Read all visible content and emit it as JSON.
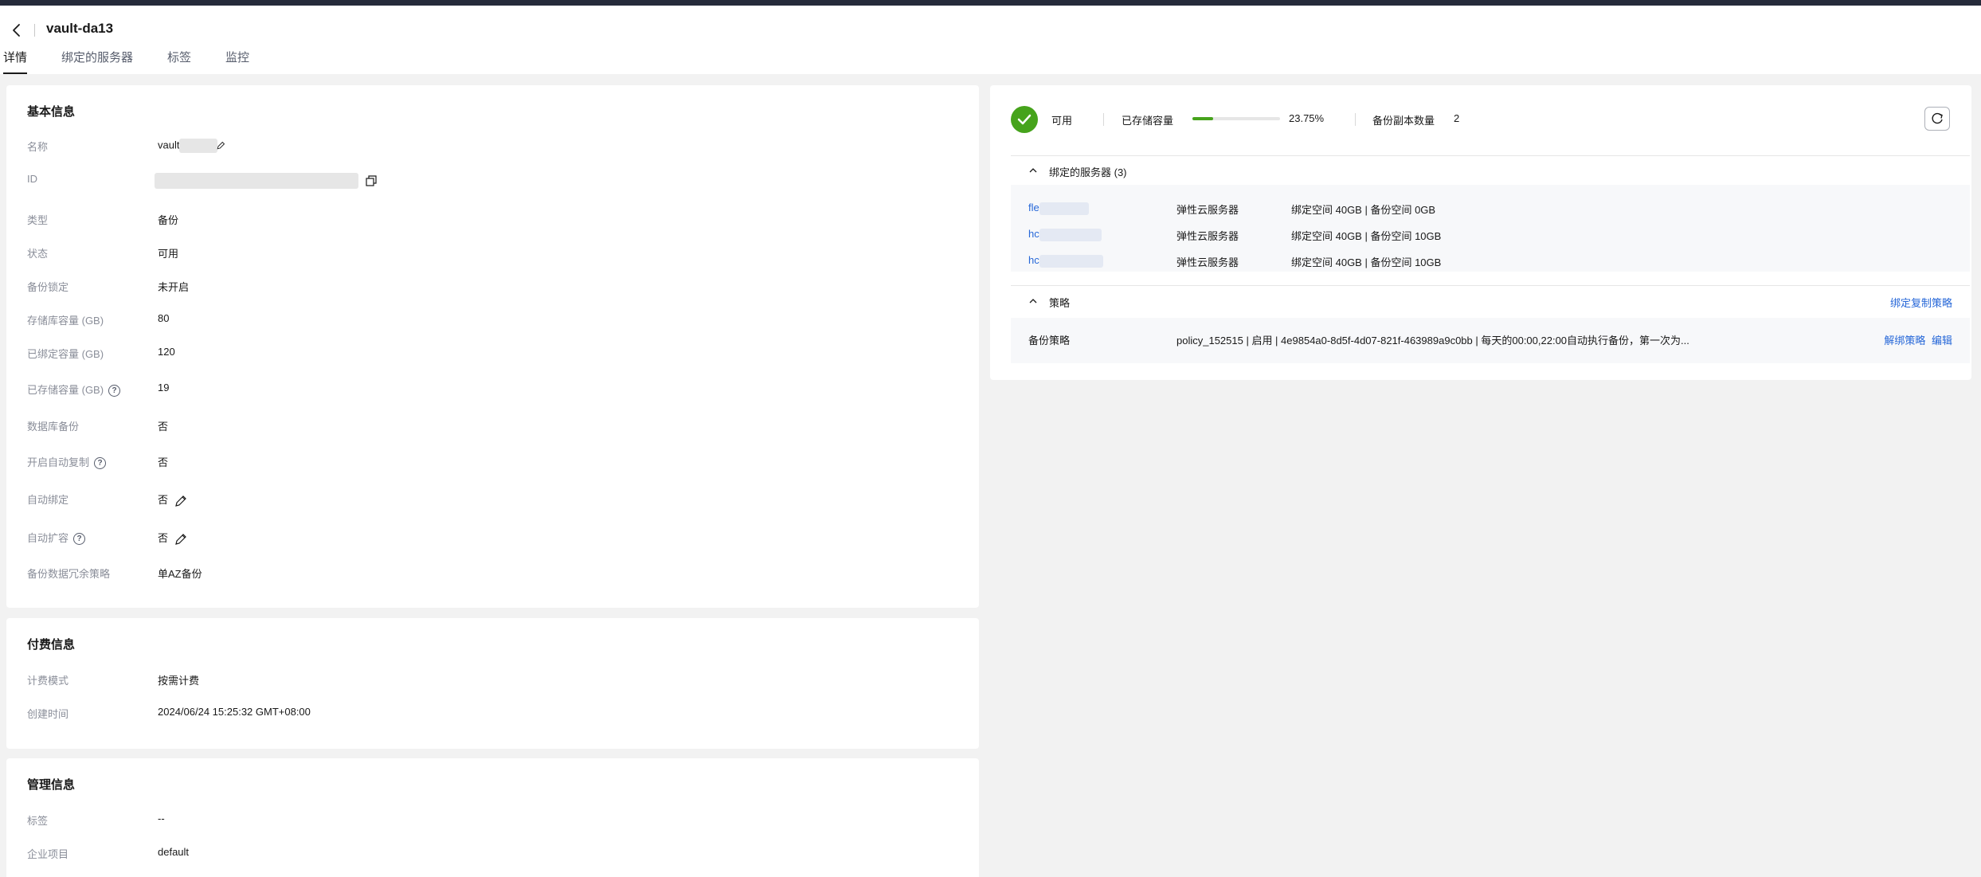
{
  "header": {
    "title": "vault-da13",
    "tabs": [
      {
        "label": "详情"
      },
      {
        "label": "绑定的服务器"
      },
      {
        "label": "标签"
      },
      {
        "label": "监控"
      }
    ]
  },
  "basic": {
    "title": "基本信息",
    "rows": [
      {
        "label": "名称",
        "value": "vault"
      },
      {
        "label": "ID",
        "value": ""
      },
      {
        "label": "类型",
        "value": "备份"
      },
      {
        "label": "状态",
        "value": "可用"
      },
      {
        "label": "备份锁定",
        "value": "未开启"
      },
      {
        "label": "存储库容量 (GB)",
        "value": "80"
      },
      {
        "label": "已绑定容量 (GB)",
        "value": "120"
      },
      {
        "label": "已存储容量 (GB)",
        "value": "19"
      },
      {
        "label": "数据库备份",
        "value": "否"
      },
      {
        "label": "开启自动复制",
        "value": "否"
      },
      {
        "label": "自动绑定",
        "value": "否"
      },
      {
        "label": "自动扩容",
        "value": "否"
      },
      {
        "label": "备份数据冗余策略",
        "value": "单AZ备份"
      }
    ]
  },
  "billing": {
    "title": "付费信息",
    "rows": [
      {
        "label": "计费模式",
        "value": "按需计费"
      },
      {
        "label": "创建时间",
        "value": "2024/06/24 15:25:32 GMT+08:00"
      }
    ]
  },
  "management": {
    "title": "管理信息",
    "rows": [
      {
        "label": "标签",
        "value": "--"
      },
      {
        "label": "企业项目",
        "value": "default"
      }
    ]
  },
  "summary": {
    "status": "可用",
    "storage_label": "已存储容量",
    "storage_percent": "23.75%",
    "storage_fraction": 0.2375,
    "replica_label": "备份副本数量",
    "replica_count": "2"
  },
  "servers": {
    "title": "绑定的服务器 (3)",
    "items": [
      {
        "name": "fle",
        "type": "弹性云服务器",
        "detail": "绑定空间 40GB | 备份空间 0GB"
      },
      {
        "name": "hc",
        "type": "弹性云服务器",
        "detail": "绑定空间 40GB | 备份空间 10GB"
      },
      {
        "name": "hc",
        "type": "弹性云服务器",
        "detail": "绑定空间 40GB | 备份空间 10GB"
      }
    ]
  },
  "policy": {
    "title": "策略",
    "bind_replication_label": "绑定复制策略",
    "row_label": "备份策略",
    "row_value": "policy_152515 | 启用 | 4e9854a0-8d5f-4d07-821f-463989a9c0bb | 每天的00:00,22:00自动执行备份，第一次为...",
    "unbind_label": "解绑策略",
    "edit_label": "编辑"
  },
  "colors": {
    "accent": "#2667d8",
    "success": "#46a31c",
    "topbar": "#252b3a"
  }
}
